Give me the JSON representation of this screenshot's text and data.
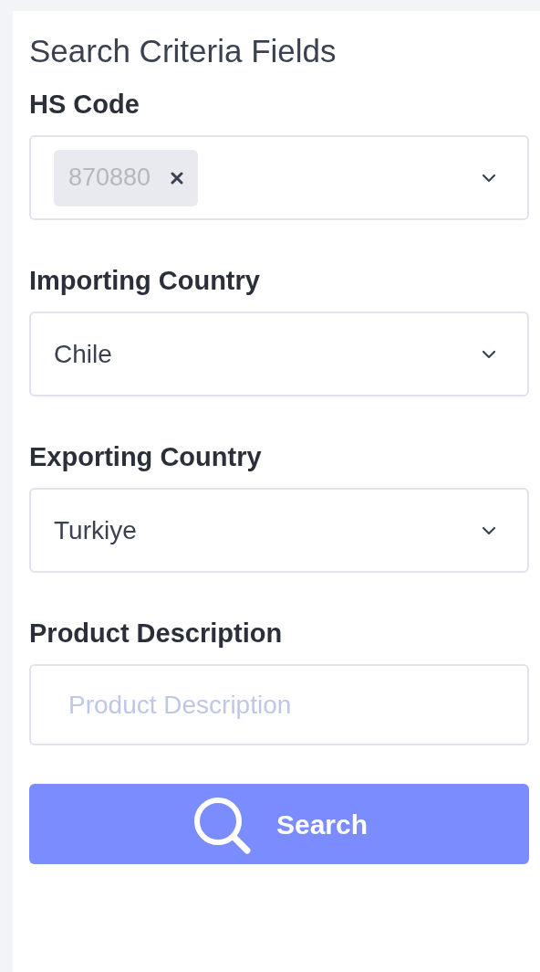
{
  "panel": {
    "title": "Search Criteria Fields"
  },
  "fields": [
    {
      "kind": "multiselect",
      "label": "HS Code",
      "tags": [
        "870880"
      ]
    },
    {
      "kind": "select",
      "label": "Importing Country",
      "value": "Chile"
    },
    {
      "kind": "select",
      "label": "Exporting Country",
      "value": "Turkiye"
    },
    {
      "kind": "text",
      "label": "Product Description",
      "placeholder": "Product Description"
    }
  ],
  "search_button": {
    "label": "Search"
  }
}
